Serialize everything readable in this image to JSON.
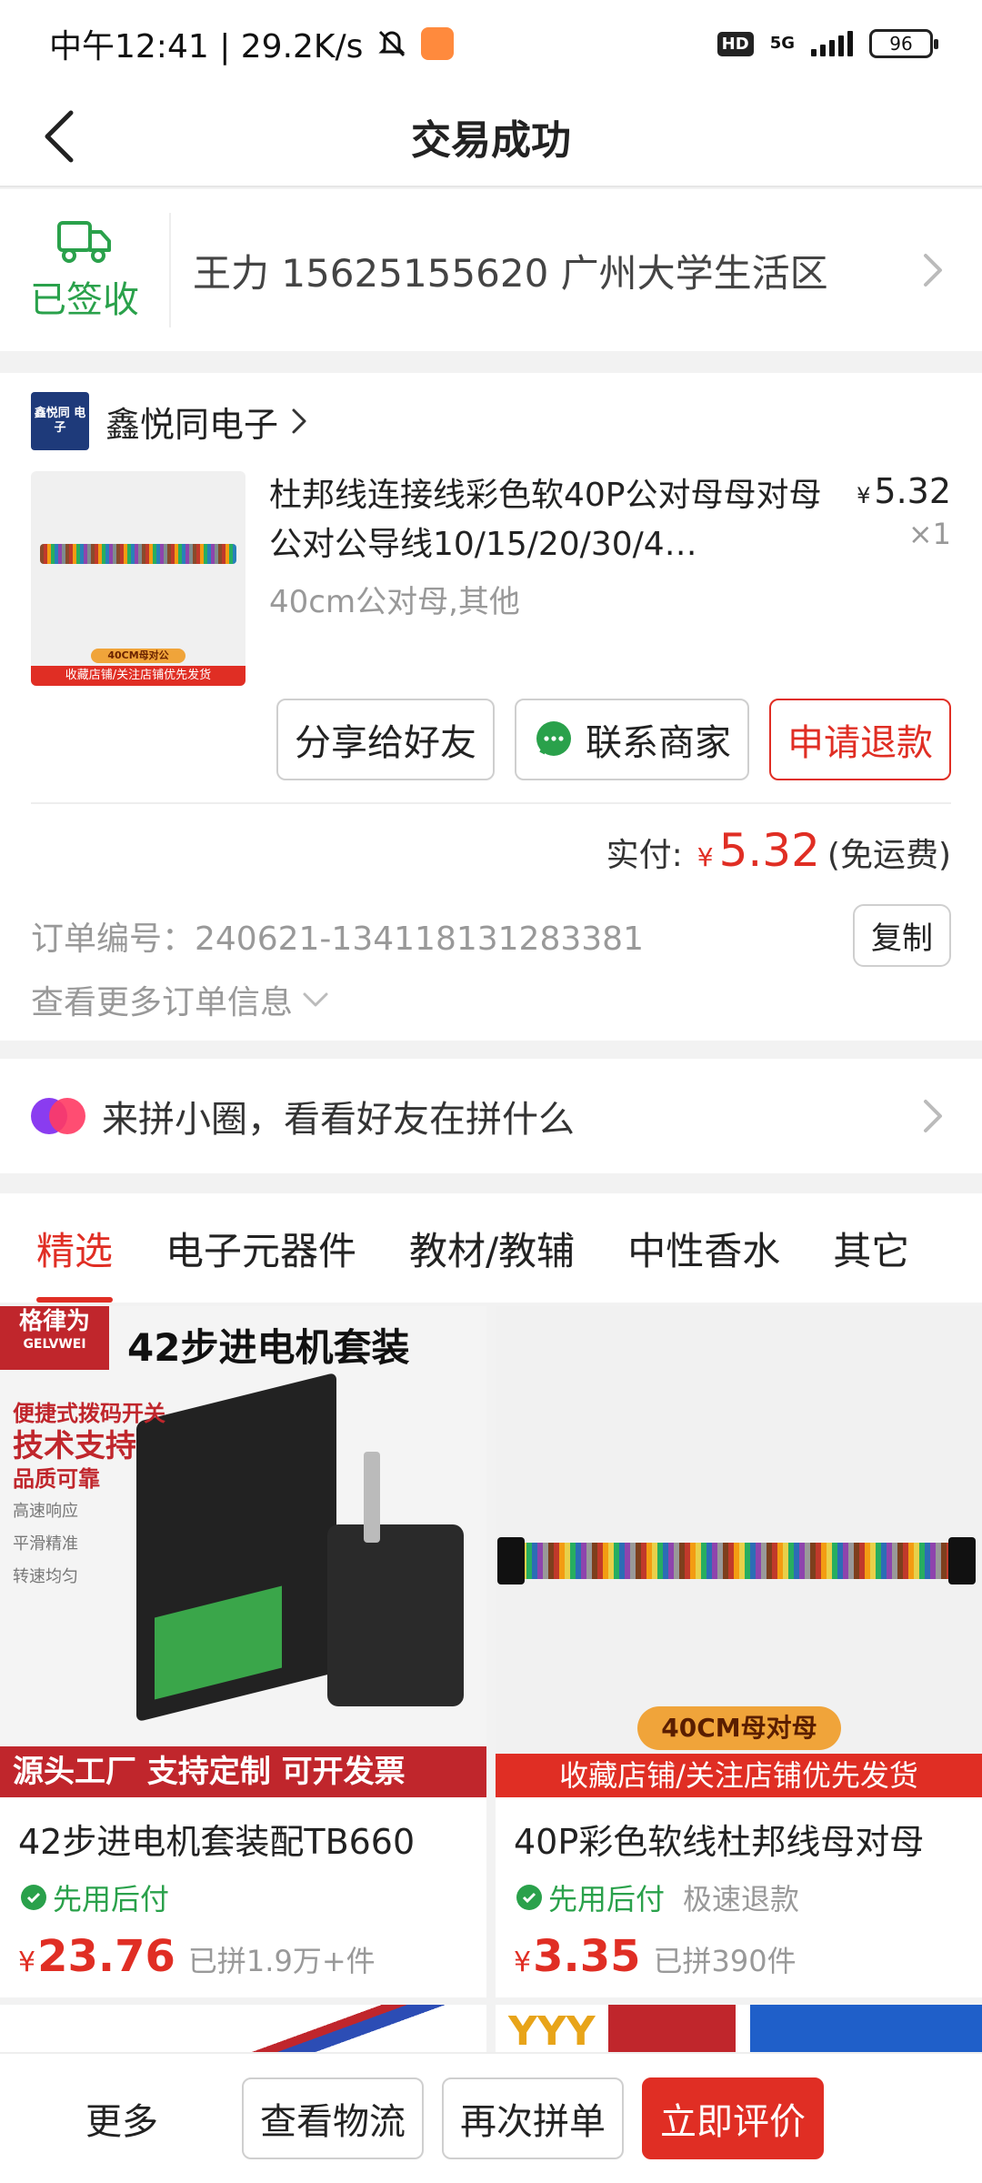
{
  "status_bar": {
    "time_text": "中午12:41 | 29.2K/s",
    "net_label": "5G",
    "hd_label": "HD",
    "battery": "96"
  },
  "nav": {
    "title": "交易成功"
  },
  "delivery": {
    "status": "已签收",
    "address": "王力 15625155620 广州大学生活区"
  },
  "order": {
    "shop_name": "鑫悦同电子",
    "shop_logo_text": "鑫悦同 电子",
    "product": {
      "title": "杜邦线连接线彩色软40P公对母母对母公对公导线10/15/20/30/4…",
      "spec": "40cm公对母,其他",
      "currency": "¥",
      "price": "5.32",
      "qty": "×1",
      "image_tag": "40CM母对公",
      "image_banner": "收藏店铺/关注店铺优先发货"
    },
    "actions": {
      "share": "分享给好友",
      "contact": "联系商家",
      "refund": "申请退款"
    },
    "paid": {
      "label": "实付:",
      "currency": "¥",
      "amount": "5.32",
      "note": "(免运费)"
    },
    "order_id": "订单编号：240621-134118131283381",
    "copy": "复制",
    "more_info": "查看更多订单信息"
  },
  "circle_banner": {
    "text": "来拼小圈，看看好友在拼什么"
  },
  "tabs": [
    "精选",
    "电子元器件",
    "教材/教辅",
    "中性香水",
    "其它"
  ],
  "products": [
    {
      "image": {
        "brand": "格律为",
        "brand_en": "GELVWEI",
        "headline": "42步进电机套装",
        "feat1": "便捷式拨码开关",
        "feat2": "技术支持",
        "feat3": "品质可靠",
        "feat4": "高速响应",
        "feat5": "平滑精准",
        "feat6": "转速均匀",
        "bottom": "源头工厂 支持定制 可开发票"
      },
      "title": "42步进电机套装配TB660",
      "tag": "先用后付",
      "extra": "",
      "currency": "¥",
      "price": "23.76",
      "sold": "已拼1.9万+件"
    },
    {
      "image": {
        "pill": "40CM母对母",
        "bottom": "收藏店铺/关注店铺优先发货"
      },
      "title": "40P彩色软线杜邦线母对母",
      "tag": "先用后付",
      "extra": "极速退款",
      "currency": "¥",
      "price": "3.35",
      "sold": "已拼390件"
    }
  ],
  "peek": {
    "yyy": "YYY"
  },
  "bottom_bar": {
    "more": "更多",
    "logistics": "查看物流",
    "reorder": "再次拼单",
    "review": "立即评价"
  },
  "colors": {
    "accent": "#e02e24",
    "success": "#2aa14b"
  }
}
